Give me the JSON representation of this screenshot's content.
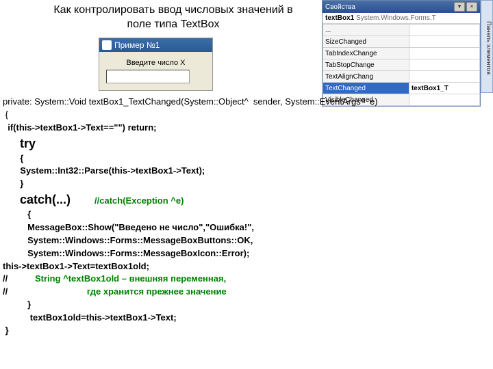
{
  "title": "Как контролировать ввод числовых значений в поле типа TextBox",
  "example": {
    "caption": "Пример №1",
    "label": "Введите число X",
    "input_value": ""
  },
  "props": {
    "title": "Свойства",
    "control": "textBox1",
    "type": "System.Windows.Forms.T",
    "rows": [
      {
        "name": "...",
        "val": ""
      },
      {
        "name": "SizeChanged",
        "val": ""
      },
      {
        "name": "TabIndexChange",
        "val": ""
      },
      {
        "name": "TabStopChange",
        "val": ""
      },
      {
        "name": "TextAlignChang",
        "val": ""
      },
      {
        "name": "TextChanged",
        "val": "textBox1_T"
      },
      {
        "name": "VisibleChanged",
        "val": ""
      }
    ],
    "selected_index": 5
  },
  "side_label": "Панель элементов",
  "code": {
    "l1": "private: System::Void textBox1_TextChanged(System::Object^  sender, System::EventArgs^  e)",
    "l2": " {",
    "l3": "  if(this->textBox1->Text==\"\") return;",
    "l4": "     try",
    "l5": "       {",
    "l6": "       System::Int32::Parse(this->textBox1->Text);",
    "l7": "       }",
    "l8a": "     catch(...)       ",
    "l8b": "//catch(Exception ^e)",
    "l9": "          {",
    "l10": "          MessageBox::Show(\"Введено не число\",\"Ошибка!\",",
    "l11": "          System::Windows::Forms::MessageBoxButtons::OK,",
    "l12": "          System::Windows::Forms::MessageBoxIcon::Error);",
    "l13": "this->textBox1->Text=textBox1old;",
    "l14a": "//           ",
    "l14b": "String ^textBox1old – внешняя переменная,",
    "l15a": "//                                ",
    "l15b": "где хранится прежнее значение",
    "l16": "          }",
    "l17": "           textBox1old=this->textBox1->Text;",
    "l18": " }"
  }
}
